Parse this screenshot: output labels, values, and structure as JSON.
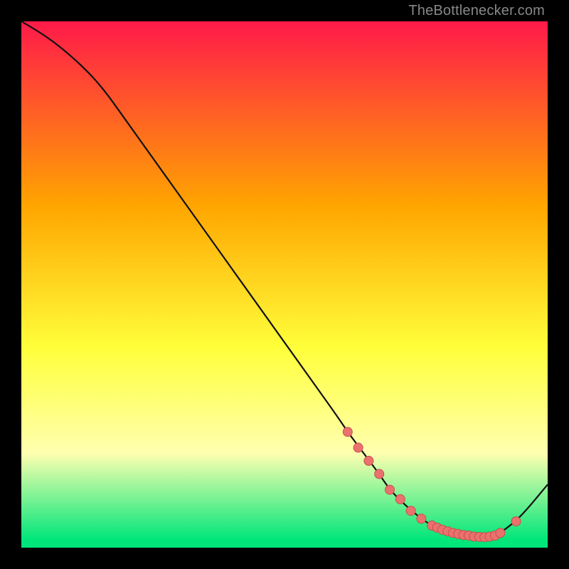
{
  "watermark": "TheBottlenecker.com",
  "colors": {
    "red": "#ff1a4a",
    "orange": "#ffa500",
    "yellow": "#ffff3a",
    "light_yellow": "#ffffb0",
    "green": "#00e67a",
    "curve": "#111111",
    "marker_fill": "#e9726e",
    "marker_stroke": "#c94f4b",
    "frame_bg": "#000000"
  },
  "chart_data": {
    "type": "line",
    "title": "",
    "xlabel": "",
    "ylabel": "",
    "xlim": [
      0,
      100
    ],
    "ylim": [
      0,
      100
    ],
    "series": [
      {
        "name": "bottleneck-curve",
        "x": [
          0,
          5,
          10,
          15,
          20,
          25,
          30,
          35,
          40,
          45,
          50,
          55,
          60,
          62,
          65,
          68,
          70,
          73,
          76,
          78,
          80,
          82,
          84,
          86,
          88,
          90,
          92,
          95,
          100
        ],
        "y": [
          100,
          97,
          93,
          88,
          81,
          74,
          67,
          60,
          53,
          46,
          39,
          32,
          25,
          22,
          18,
          14,
          11,
          8,
          5.5,
          4.2,
          3.4,
          2.8,
          2.4,
          2.1,
          2.0,
          2.3,
          3.5,
          6,
          12
        ]
      }
    ],
    "markers": {
      "name": "highlighted-points",
      "x": [
        62,
        64,
        66,
        68,
        70,
        72,
        74,
        76,
        78,
        79,
        80,
        81,
        82,
        83,
        84,
        85,
        86,
        87,
        88,
        89,
        90,
        91,
        94
      ],
      "y": [
        22,
        19,
        16.5,
        14,
        11,
        9.2,
        7,
        5.5,
        4.2,
        3.8,
        3.4,
        3.1,
        2.8,
        2.6,
        2.4,
        2.3,
        2.1,
        2.05,
        2.0,
        2.1,
        2.3,
        2.8,
        5.0
      ]
    },
    "gradient_stops": [
      {
        "offset": 0.0,
        "key": "red"
      },
      {
        "offset": 0.35,
        "key": "orange"
      },
      {
        "offset": 0.62,
        "key": "yellow"
      },
      {
        "offset": 0.82,
        "key": "light_yellow"
      },
      {
        "offset": 0.985,
        "key": "green"
      }
    ]
  }
}
